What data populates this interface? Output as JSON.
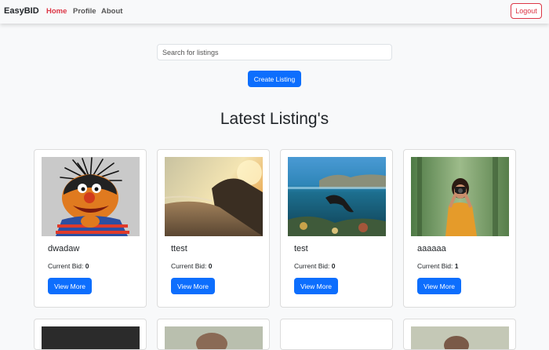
{
  "navbar": {
    "brand": "EasyBID",
    "links": [
      {
        "label": "Home",
        "active": true
      },
      {
        "label": "Profile",
        "active": false
      },
      {
        "label": "About",
        "active": false
      }
    ],
    "logout_label": "Logout"
  },
  "search": {
    "placeholder": "Search for listings",
    "value": ""
  },
  "create_listing_label": "Create Listing",
  "heading": "Latest Listing's",
  "listings": [
    {
      "title": "dwadaw",
      "bid_label": "Current Bid:",
      "bid_value": "0",
      "button_label": "View More",
      "image": "muppet-photo"
    },
    {
      "title": "ttest",
      "bid_label": "Current Bid:",
      "bid_value": "0",
      "button_label": "View More",
      "image": "beach-sunset-photo"
    },
    {
      "title": "test",
      "bid_label": "Current Bid:",
      "bid_value": "0",
      "button_label": "View More",
      "image": "underwater-swimmer-photo"
    },
    {
      "title": "aaaaaa",
      "bid_label": "Current Bid:",
      "bid_value": "1",
      "button_label": "View More",
      "image": "photographer-woman-photo"
    }
  ],
  "colors": {
    "brand_red": "#dc3545",
    "primary_blue": "#0d6efd",
    "background": "#f8f9fa"
  }
}
